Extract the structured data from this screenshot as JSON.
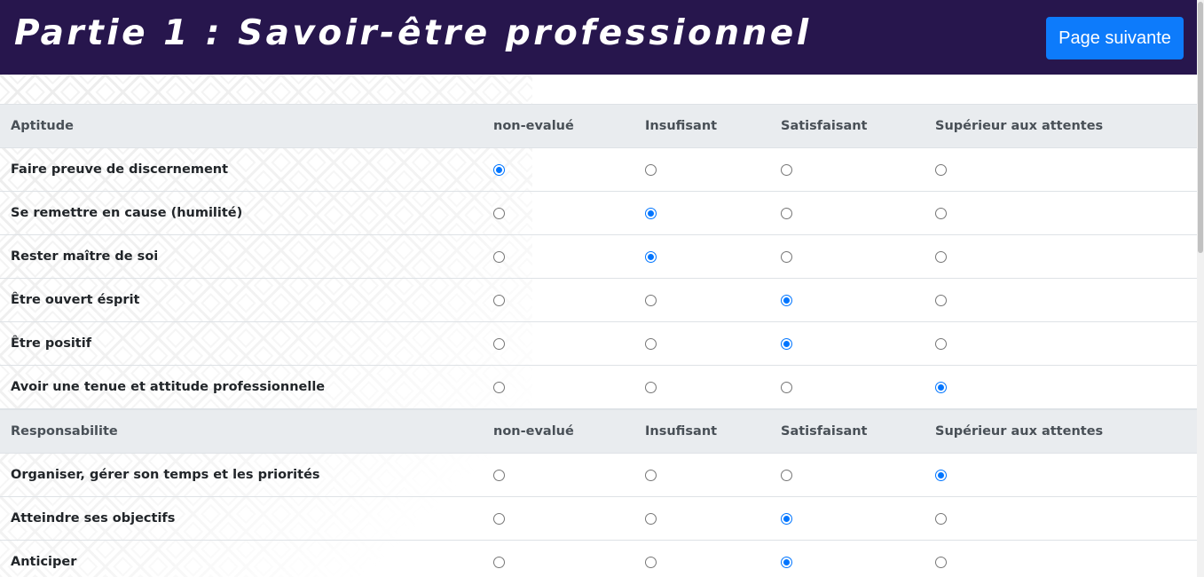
{
  "header": {
    "title": "Partie 1 : Savoir-être professionnel",
    "next_button": "Page suivante"
  },
  "columns": [
    "non-evalué",
    "Insufisant",
    "Satisfaisant",
    "Supérieur aux attentes"
  ],
  "sections": [
    {
      "title": "Aptitude",
      "columns": [
        "non-evalué",
        "Insufisant",
        "Satisfaisant",
        "Supérieur aux attentes"
      ],
      "rows": [
        {
          "label": "Faire preuve de discernement",
          "selected": 0
        },
        {
          "label": "Se remettre en cause (humilité)",
          "selected": 1
        },
        {
          "label": "Rester maître de soi",
          "selected": 1
        },
        {
          "label": "Être ouvert ésprit",
          "selected": 2
        },
        {
          "label": "Être positif",
          "selected": 2
        },
        {
          "label": "Avoir une tenue et attitude professionnelle",
          "selected": 3
        }
      ]
    },
    {
      "title": "Responsabilite",
      "columns": [
        "non-evalué",
        "Insufisant",
        "Satisfaisant",
        "Supérieur aux attentes"
      ],
      "rows": [
        {
          "label": "Organiser, gérer son temps et les priorités",
          "selected": 3
        },
        {
          "label": "Atteindre ses objectifs",
          "selected": 2
        },
        {
          "label": "Anticiper",
          "selected": 2
        }
      ]
    }
  ],
  "colors": {
    "header_bg": "#27164d",
    "button_bg": "#0d7bfb",
    "section_bg": "#e9ecef",
    "radio_checked": "#0075ff"
  }
}
